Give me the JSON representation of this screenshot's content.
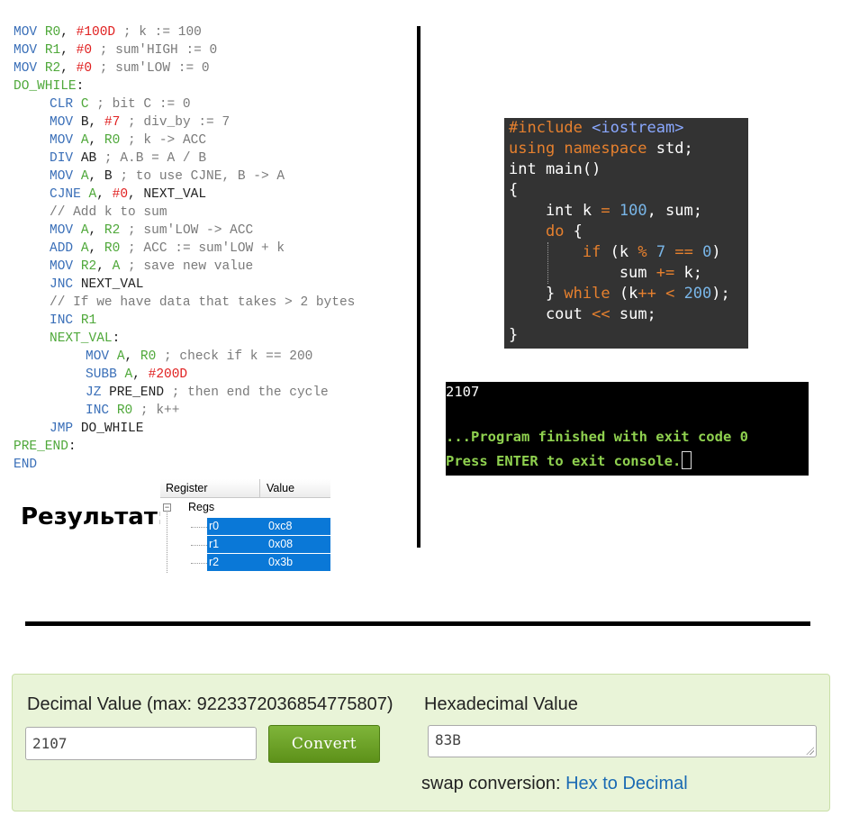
{
  "asm": {
    "lines": [
      {
        "indent": 0,
        "tokens": [
          [
            "kw",
            "MOV "
          ],
          [
            "reg",
            "R0"
          ],
          [
            "txt",
            ", "
          ],
          [
            "num",
            "#100D"
          ],
          [
            "cmt",
            " ; k := 100"
          ]
        ]
      },
      {
        "indent": 0,
        "tokens": [
          [
            "kw",
            "MOV "
          ],
          [
            "reg",
            "R1"
          ],
          [
            "txt",
            ", "
          ],
          [
            "num",
            "#0"
          ],
          [
            "cmt",
            " ; sum'HIGH := 0"
          ]
        ]
      },
      {
        "indent": 0,
        "tokens": [
          [
            "kw",
            "MOV "
          ],
          [
            "reg",
            "R2"
          ],
          [
            "txt",
            ", "
          ],
          [
            "num",
            "#0"
          ],
          [
            "cmt",
            " ; sum'LOW := 0"
          ]
        ]
      },
      {
        "indent": 0,
        "tokens": [
          [
            "lbl",
            "DO_WHILE"
          ],
          [
            "txt",
            ":"
          ]
        ]
      },
      {
        "indent": 1,
        "tokens": [
          [
            "kw",
            "CLR "
          ],
          [
            "reg",
            "C"
          ],
          [
            "cmt",
            " ; bit C := 0"
          ]
        ]
      },
      {
        "indent": 1,
        "tokens": [
          [
            "kw",
            "MOV "
          ],
          [
            "kwb",
            "B"
          ],
          [
            "txt",
            ", "
          ],
          [
            "num",
            "#7"
          ],
          [
            "cmt",
            " ; div_by := 7"
          ]
        ]
      },
      {
        "indent": 1,
        "tokens": [
          [
            "kw",
            "MOV "
          ],
          [
            "reg",
            "A"
          ],
          [
            "txt",
            ", "
          ],
          [
            "reg",
            "R0"
          ],
          [
            "cmt",
            " ; k -> ACC"
          ]
        ]
      },
      {
        "indent": 1,
        "tokens": [
          [
            "kw",
            "DIV "
          ],
          [
            "kwb",
            "AB"
          ],
          [
            "cmt",
            " ; A.B = A / B"
          ]
        ]
      },
      {
        "indent": 1,
        "tokens": [
          [
            "kw",
            "MOV "
          ],
          [
            "reg",
            "A"
          ],
          [
            "txt",
            ", "
          ],
          [
            "kwb",
            "B"
          ],
          [
            "cmt",
            " ; to use CJNE, B -> A"
          ]
        ]
      },
      {
        "indent": 1,
        "tokens": [
          [
            "kw",
            "CJNE "
          ],
          [
            "reg",
            "A"
          ],
          [
            "txt",
            ", "
          ],
          [
            "num",
            "#0"
          ],
          [
            "txt",
            ", NEXT_VAL"
          ]
        ]
      },
      {
        "indent": 1,
        "tokens": [
          [
            "cmt",
            "// Add k to sum"
          ]
        ]
      },
      {
        "indent": 1,
        "tokens": [
          [
            "kw",
            "MOV "
          ],
          [
            "reg",
            "A"
          ],
          [
            "txt",
            ", "
          ],
          [
            "reg",
            "R2"
          ],
          [
            "cmt",
            " ; sum'LOW -> ACC"
          ]
        ]
      },
      {
        "indent": 1,
        "tokens": [
          [
            "kw",
            "ADD "
          ],
          [
            "reg",
            "A"
          ],
          [
            "txt",
            ", "
          ],
          [
            "reg",
            "R0"
          ],
          [
            "cmt",
            " ; ACC := sum'LOW + k"
          ]
        ]
      },
      {
        "indent": 1,
        "tokens": [
          [
            "kw",
            "MOV "
          ],
          [
            "reg",
            "R2"
          ],
          [
            "txt",
            ", "
          ],
          [
            "reg",
            "A"
          ],
          [
            "cmt",
            " ; save new value"
          ]
        ]
      },
      {
        "indent": 1,
        "tokens": [
          [
            "kw",
            "JNC "
          ],
          [
            "txt",
            "NEXT_VAL"
          ]
        ]
      },
      {
        "indent": 1,
        "tokens": [
          [
            "cmt",
            "// If we have data that takes > 2 bytes"
          ]
        ]
      },
      {
        "indent": 1,
        "tokens": [
          [
            "kw",
            "INC "
          ],
          [
            "reg",
            "R1"
          ]
        ]
      },
      {
        "indent": 1,
        "tokens": [
          [
            "lbl",
            "NEXT_VAL"
          ],
          [
            "txt",
            ":"
          ]
        ]
      },
      {
        "indent": 2,
        "tokens": [
          [
            "kw",
            "MOV "
          ],
          [
            "reg",
            "A"
          ],
          [
            "txt",
            ", "
          ],
          [
            "reg",
            "R0"
          ],
          [
            "cmt",
            " ; check if k == 200"
          ]
        ]
      },
      {
        "indent": 2,
        "tokens": [
          [
            "kw",
            "SUBB "
          ],
          [
            "reg",
            "A"
          ],
          [
            "txt",
            ", "
          ],
          [
            "num",
            "#200D"
          ]
        ]
      },
      {
        "indent": 2,
        "tokens": [
          [
            "kw",
            "JZ "
          ],
          [
            "txt",
            "PRE_END"
          ],
          [
            "cmt",
            " ; then end the cycle"
          ]
        ]
      },
      {
        "indent": 2,
        "tokens": [
          [
            "kw",
            "INC "
          ],
          [
            "reg",
            "R0"
          ],
          [
            "cmt",
            " ; k++"
          ]
        ]
      },
      {
        "indent": 1,
        "tokens": [
          [
            "kw",
            "JMP "
          ],
          [
            "txt",
            "DO_WHILE"
          ]
        ]
      },
      {
        "indent": 0,
        "tokens": [
          [
            "lbl",
            "PRE_END"
          ],
          [
            "txt",
            ":"
          ]
        ]
      },
      {
        "indent": 0,
        "tokens": [
          [
            "kw",
            "END"
          ]
        ]
      }
    ]
  },
  "result_label": "Результат:",
  "registers": {
    "header_register": "Register",
    "header_value": "Value",
    "group": "Regs",
    "rows": [
      {
        "name": "r0",
        "value": "0xc8"
      },
      {
        "name": "r1",
        "value": "0x08"
      },
      {
        "name": "r2",
        "value": "0x3b"
      }
    ]
  },
  "cpp": {
    "lines": [
      [
        [
          "pp",
          "#include "
        ],
        [
          "inc",
          "<iostream>"
        ]
      ],
      [
        [
          "kw",
          "using namespace "
        ],
        [
          "txt",
          "std;"
        ]
      ],
      [
        [
          "txt",
          "int main()"
        ]
      ],
      [
        [
          "txt",
          "{"
        ]
      ],
      [
        [
          "txt",
          "    int k "
        ],
        [
          "op",
          "="
        ],
        [
          "txt",
          " "
        ],
        [
          "num",
          "100"
        ],
        [
          "txt",
          ", sum;"
        ]
      ],
      [
        [
          "txt",
          "    "
        ],
        [
          "kw",
          "do"
        ],
        [
          "txt",
          " {"
        ]
      ],
      [
        [
          "txt",
          "        "
        ],
        [
          "kw",
          "if"
        ],
        [
          "txt",
          " (k "
        ],
        [
          "op",
          "%"
        ],
        [
          "txt",
          " "
        ],
        [
          "num",
          "7"
        ],
        [
          "txt",
          " "
        ],
        [
          "op",
          "=="
        ],
        [
          "txt",
          " "
        ],
        [
          "num",
          "0"
        ],
        [
          "txt",
          ")"
        ]
      ],
      [
        [
          "txt",
          "            sum "
        ],
        [
          "op",
          "+="
        ],
        [
          "txt",
          " k;"
        ]
      ],
      [
        [
          "txt",
          "    } "
        ],
        [
          "kw",
          "while"
        ],
        [
          "txt",
          " (k"
        ],
        [
          "op",
          "++"
        ],
        [
          "txt",
          " "
        ],
        [
          "op",
          "<"
        ],
        [
          "txt",
          " "
        ],
        [
          "num",
          "200"
        ],
        [
          "txt",
          ");"
        ]
      ],
      [
        [
          "txt",
          "    cout "
        ],
        [
          "op",
          "<<"
        ],
        [
          "txt",
          " sum;"
        ]
      ],
      [
        [
          "txt",
          "}"
        ]
      ]
    ]
  },
  "console": {
    "output": "2107",
    "finished": "...Program finished with exit code 0",
    "press": "Press ENTER to exit console."
  },
  "converter": {
    "decimal_label": "Decimal Value (max: 9223372036854775807)",
    "hex_label": "Hexadecimal Value",
    "decimal_value": "2107",
    "hex_value": "83B",
    "convert_label": "Convert",
    "swap_prefix": "swap conversion: ",
    "swap_link": "Hex to Decimal"
  }
}
